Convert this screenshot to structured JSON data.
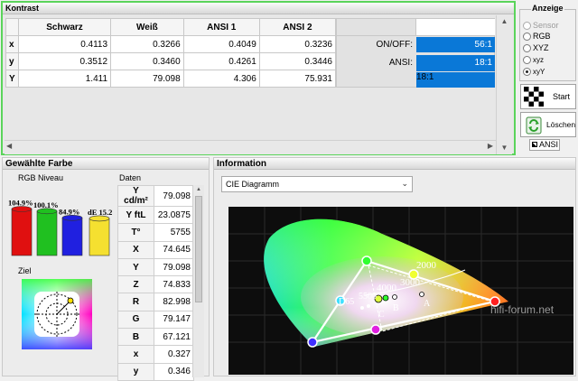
{
  "kontrast": {
    "title": "Kontrast",
    "columns": [
      "",
      "Schwarz",
      "Weiß",
      "ANSI 1",
      "ANSI 2"
    ],
    "rows": [
      {
        "label": "x",
        "values": [
          "0.4113",
          "0.3266",
          "0.4049",
          "0.3236"
        ]
      },
      {
        "label": "y",
        "values": [
          "0.3512",
          "0.3460",
          "0.4261",
          "0.3446"
        ]
      },
      {
        "label": "Y",
        "values": [
          "1.411",
          "79.098",
          "4.306",
          "75.931"
        ]
      }
    ],
    "onoff_label": "ON/OFF:",
    "onoff_value": "56:1",
    "ansi_label": "ANSI:",
    "ansi_value": "18:1"
  },
  "anzeige": {
    "title": "Anzeige",
    "options": [
      "Sensor",
      "RGB",
      "XYZ",
      "xyz",
      "xyY"
    ],
    "selected": "xyY"
  },
  "start_label": "Start",
  "loeschen_label": "Löschen",
  "ansi_button_label": "ANSI",
  "gewaehlte": {
    "title": "Gewählte Farbe",
    "rgb_niveau": "RGB Niveau",
    "bars": [
      {
        "label": "104.9%",
        "value": 104.9,
        "color": "#e01010"
      },
      {
        "label": "100.1%",
        "value": 100.1,
        "color": "#20c020"
      },
      {
        "label": "84.9%",
        "value": 84.9,
        "color": "#2020e0"
      }
    ],
    "de_label": "dE 15.2",
    "de_value": 15.2,
    "ziel": "Ziel",
    "daten_title": "Daten",
    "daten": [
      {
        "k": "Y cd/m²",
        "v": "79.098"
      },
      {
        "k": "Y ftL",
        "v": "23.0875"
      },
      {
        "k": "T°",
        "v": "5755"
      },
      {
        "k": "X",
        "v": "74.645"
      },
      {
        "k": "Y",
        "v": "79.098"
      },
      {
        "k": "Z",
        "v": "74.833"
      },
      {
        "k": "R",
        "v": "82.998"
      },
      {
        "k": "G",
        "v": "79.147"
      },
      {
        "k": "B",
        "v": "67.121"
      },
      {
        "k": "x",
        "v": "0.327"
      },
      {
        "k": "y",
        "v": "0.346"
      }
    ]
  },
  "information": {
    "title": "Information",
    "select_value": "CIE Diagramm",
    "chart_labels": {
      "t2000": "2000",
      "t3000": "3000",
      "t4000": "4000",
      "d65": "D65",
      "a": "A",
      "b": "B",
      "c": "C",
      "t5500": "5500",
      "watermark": "hifi-forum.net"
    }
  }
}
